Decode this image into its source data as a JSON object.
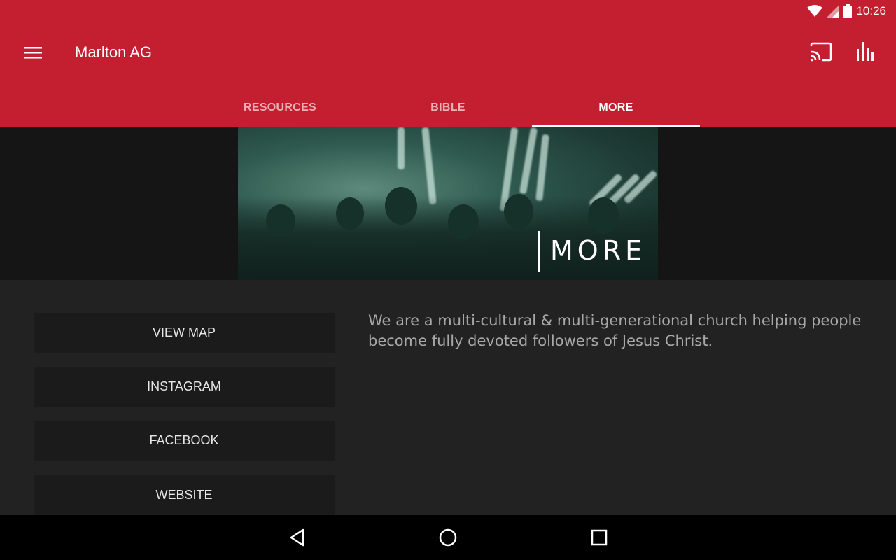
{
  "status_bar": {
    "time": "10:26",
    "icons": [
      "wifi-icon",
      "signal-icon",
      "battery-icon"
    ]
  },
  "app_bar": {
    "title": "Marlton AG",
    "icons": [
      "menu-icon",
      "cast-icon",
      "stats-icon"
    ]
  },
  "tabs": [
    {
      "label": "RESOURCES",
      "active": false
    },
    {
      "label": "BIBLE",
      "active": false
    },
    {
      "label": "MORE",
      "active": true
    }
  ],
  "hero": {
    "label": "MORE"
  },
  "buttons": [
    {
      "label": "VIEW MAP"
    },
    {
      "label": "INSTAGRAM"
    },
    {
      "label": "FACEBOOK"
    },
    {
      "label": "WEBSITE"
    }
  ],
  "description": "We are a multi-cultural & multi-generational church helping people become fully devoted followers of Jesus Christ.",
  "nav_bar": {
    "icons": [
      "back-icon",
      "home-icon",
      "recents-icon"
    ]
  },
  "colors": {
    "accent": "#c41f30",
    "background": "#222222",
    "button": "#1b1b1b",
    "hero_band": "#151515"
  }
}
